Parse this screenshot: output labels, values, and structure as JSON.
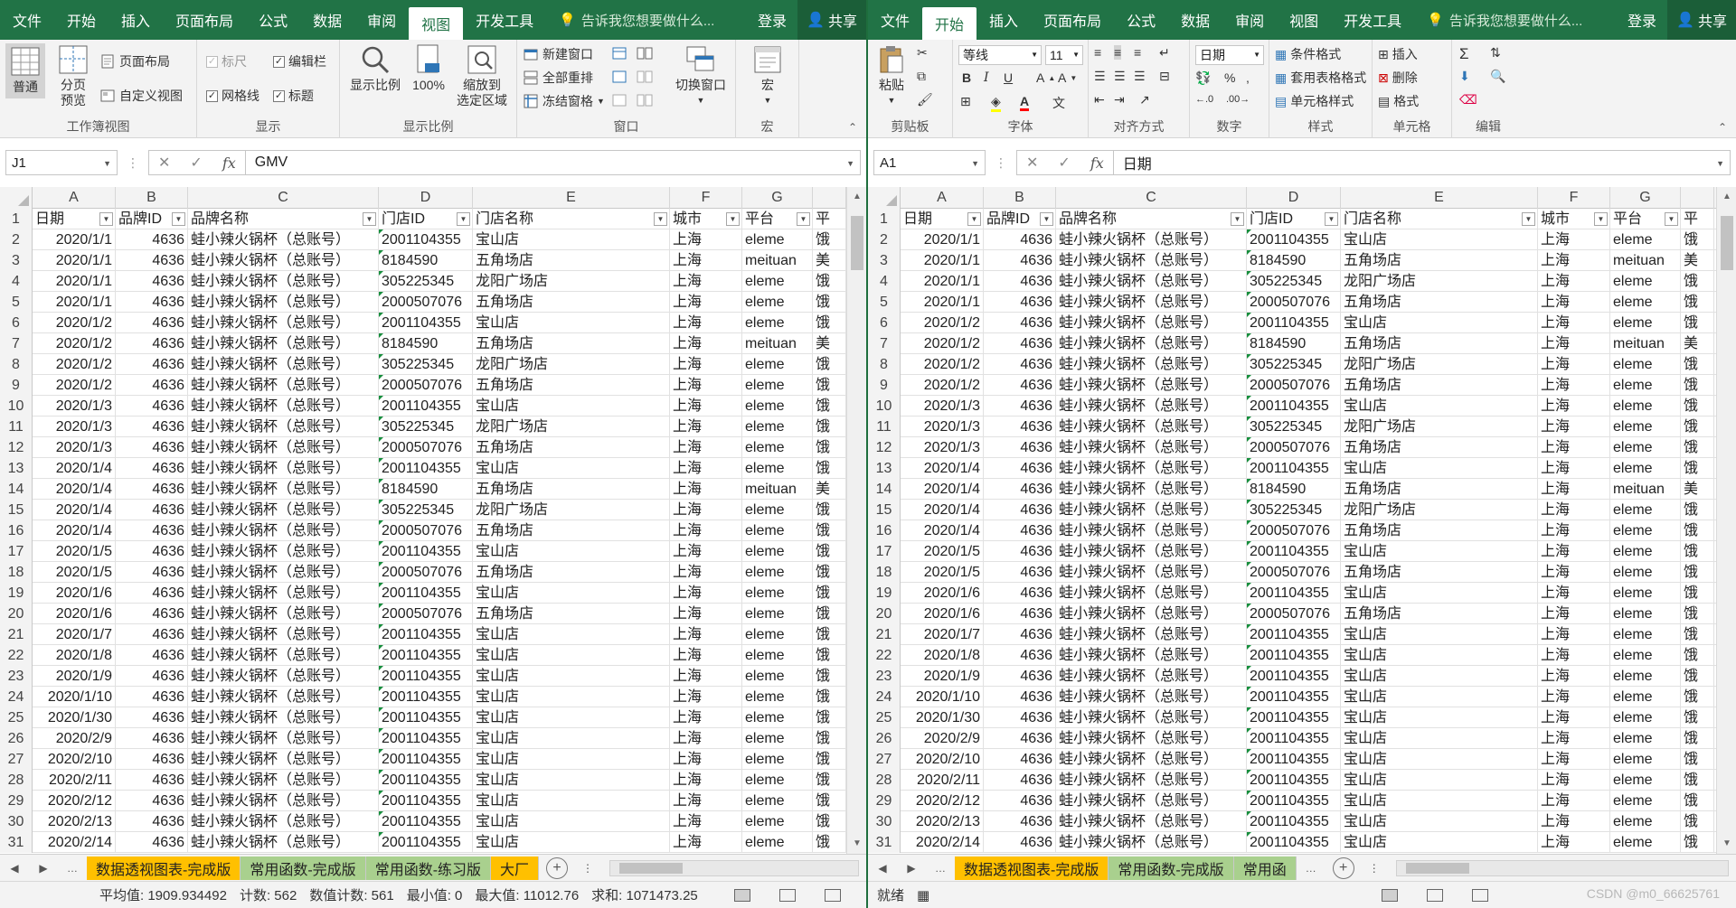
{
  "left": {
    "tabs": [
      "文件",
      "开始",
      "插入",
      "页面布局",
      "公式",
      "数据",
      "审阅",
      "视图",
      "开发工具"
    ],
    "active_tab": "视图",
    "tell_me": "告诉我您想要做什么...",
    "login": "登录",
    "share": "共享",
    "ribbon": {
      "g_workbook_views": {
        "label": "工作簿视图",
        "normal": "普通",
        "page_break": "分页\n预览",
        "page_layout": "页面布局",
        "custom_view": "自定义视图"
      },
      "g_show": {
        "label": "显示",
        "ruler": "标尺",
        "formula_bar": "编辑栏",
        "gridlines": "网格线",
        "headings": "标题"
      },
      "g_zoom": {
        "label": "显示比例",
        "zoom": "显示比例",
        "zoom100": "100%",
        "zoom_sel": "缩放到\n选定区域"
      },
      "g_window": {
        "label": "窗口",
        "new_window": "新建窗口",
        "arrange_all": "全部重排",
        "freeze": "冻结窗格",
        "switch": "切换窗口"
      },
      "g_macro": {
        "label": "宏",
        "macro": "宏"
      }
    },
    "name_box": "J1",
    "formula_value": "GMV",
    "columns": [
      "A",
      "B",
      "C",
      "D",
      "E",
      "F",
      "G",
      ""
    ],
    "header_row": [
      "日期",
      "品牌ID",
      "品牌名称",
      "门店ID",
      "门店名称",
      "城市",
      "平台",
      "平"
    ],
    "sheet_tabs": [
      {
        "label": "数据透视图表-完成版",
        "color": "#ffc000"
      },
      {
        "label": "常用函数-完成版",
        "color": "#a9d08e"
      },
      {
        "label": "常用函数-练习版",
        "color": "#a9d08e"
      },
      {
        "label": "大厂",
        "color": "#ffc000"
      }
    ],
    "status": {
      "avg": "平均值: 1909.934492",
      "count": "计数: 562",
      "numcount": "数值计数: 561",
      "min": "最小值: 0",
      "max": "最大值: 11012.76",
      "sum": "求和: 1071473.25"
    }
  },
  "right": {
    "tabs": [
      "文件",
      "开始",
      "插入",
      "页面布局",
      "公式",
      "数据",
      "审阅",
      "视图",
      "开发工具"
    ],
    "active_tab": "开始",
    "tell_me": "告诉我您想要做什么...",
    "login": "登录",
    "share": "共享",
    "ribbon": {
      "clipboard": {
        "label": "剪贴板",
        "paste": "粘贴"
      },
      "font": {
        "label": "字体",
        "name": "等线",
        "size": "11",
        "bold": "B",
        "italic": "I",
        "underline": "U"
      },
      "align": {
        "label": "对齐方式"
      },
      "number": {
        "label": "数字",
        "format": "日期",
        "percent": "%"
      },
      "styles": {
        "label": "样式",
        "cond": "条件格式",
        "table": "套用表格格式",
        "cell": "单元格样式"
      },
      "cells": {
        "label": "单元格",
        "insert": "插入",
        "delete": "删除",
        "format": "格式"
      },
      "edit": {
        "label": "编辑"
      }
    },
    "name_box": "A1",
    "formula_value": "日期",
    "columns": [
      "A",
      "B",
      "C",
      "D",
      "E",
      "F",
      "G",
      ""
    ],
    "header_row": [
      "日期",
      "品牌ID",
      "品牌名称",
      "门店ID",
      "门店名称",
      "城市",
      "平台",
      "平"
    ],
    "sheet_tabs": [
      {
        "label": "数据透视图表-完成版",
        "color": "#ffc000"
      },
      {
        "label": "常用函数-完成版",
        "color": "#a9d08e"
      },
      {
        "label": "常用函",
        "color": "#a9d08e"
      }
    ],
    "status": {
      "ready": "就绪"
    }
  },
  "rows": [
    {
      "n": 2,
      "date": "2020/1/1",
      "bid": "4636",
      "brand": "蛙小辣火锅杯（总账号）",
      "sid": "2001104355",
      "sname": "宝山店",
      "city": "上海",
      "plat": "eleme",
      "p2": "饿"
    },
    {
      "n": 3,
      "date": "2020/1/1",
      "bid": "4636",
      "brand": "蛙小辣火锅杯（总账号）",
      "sid": "8184590",
      "sname": "五角场店",
      "city": "上海",
      "plat": "meituan",
      "p2": "美"
    },
    {
      "n": 4,
      "date": "2020/1/1",
      "bid": "4636",
      "brand": "蛙小辣火锅杯（总账号）",
      "sid": "305225345",
      "sname": "龙阳广场店",
      "city": "上海",
      "plat": "eleme",
      "p2": "饿"
    },
    {
      "n": 5,
      "date": "2020/1/1",
      "bid": "4636",
      "brand": "蛙小辣火锅杯（总账号）",
      "sid": "2000507076",
      "sname": "五角场店",
      "city": "上海",
      "plat": "eleme",
      "p2": "饿"
    },
    {
      "n": 6,
      "date": "2020/1/2",
      "bid": "4636",
      "brand": "蛙小辣火锅杯（总账号）",
      "sid": "2001104355",
      "sname": "宝山店",
      "city": "上海",
      "plat": "eleme",
      "p2": "饿"
    },
    {
      "n": 7,
      "date": "2020/1/2",
      "bid": "4636",
      "brand": "蛙小辣火锅杯（总账号）",
      "sid": "8184590",
      "sname": "五角场店",
      "city": "上海",
      "plat": "meituan",
      "p2": "美"
    },
    {
      "n": 8,
      "date": "2020/1/2",
      "bid": "4636",
      "brand": "蛙小辣火锅杯（总账号）",
      "sid": "305225345",
      "sname": "龙阳广场店",
      "city": "上海",
      "plat": "eleme",
      "p2": "饿"
    },
    {
      "n": 9,
      "date": "2020/1/2",
      "bid": "4636",
      "brand": "蛙小辣火锅杯（总账号）",
      "sid": "2000507076",
      "sname": "五角场店",
      "city": "上海",
      "plat": "eleme",
      "p2": "饿"
    },
    {
      "n": 10,
      "date": "2020/1/3",
      "bid": "4636",
      "brand": "蛙小辣火锅杯（总账号）",
      "sid": "2001104355",
      "sname": "宝山店",
      "city": "上海",
      "plat": "eleme",
      "p2": "饿"
    },
    {
      "n": 11,
      "date": "2020/1/3",
      "bid": "4636",
      "brand": "蛙小辣火锅杯（总账号）",
      "sid": "305225345",
      "sname": "龙阳广场店",
      "city": "上海",
      "plat": "eleme",
      "p2": "饿"
    },
    {
      "n": 12,
      "date": "2020/1/3",
      "bid": "4636",
      "brand": "蛙小辣火锅杯（总账号）",
      "sid": "2000507076",
      "sname": "五角场店",
      "city": "上海",
      "plat": "eleme",
      "p2": "饿"
    },
    {
      "n": 13,
      "date": "2020/1/4",
      "bid": "4636",
      "brand": "蛙小辣火锅杯（总账号）",
      "sid": "2001104355",
      "sname": "宝山店",
      "city": "上海",
      "plat": "eleme",
      "p2": "饿"
    },
    {
      "n": 14,
      "date": "2020/1/4",
      "bid": "4636",
      "brand": "蛙小辣火锅杯（总账号）",
      "sid": "8184590",
      "sname": "五角场店",
      "city": "上海",
      "plat": "meituan",
      "p2": "美"
    },
    {
      "n": 15,
      "date": "2020/1/4",
      "bid": "4636",
      "brand": "蛙小辣火锅杯（总账号）",
      "sid": "305225345",
      "sname": "龙阳广场店",
      "city": "上海",
      "plat": "eleme",
      "p2": "饿"
    },
    {
      "n": 16,
      "date": "2020/1/4",
      "bid": "4636",
      "brand": "蛙小辣火锅杯（总账号）",
      "sid": "2000507076",
      "sname": "五角场店",
      "city": "上海",
      "plat": "eleme",
      "p2": "饿"
    },
    {
      "n": 17,
      "date": "2020/1/5",
      "bid": "4636",
      "brand": "蛙小辣火锅杯（总账号）",
      "sid": "2001104355",
      "sname": "宝山店",
      "city": "上海",
      "plat": "eleme",
      "p2": "饿"
    },
    {
      "n": 18,
      "date": "2020/1/5",
      "bid": "4636",
      "brand": "蛙小辣火锅杯（总账号）",
      "sid": "2000507076",
      "sname": "五角场店",
      "city": "上海",
      "plat": "eleme",
      "p2": "饿"
    },
    {
      "n": 19,
      "date": "2020/1/6",
      "bid": "4636",
      "brand": "蛙小辣火锅杯（总账号）",
      "sid": "2001104355",
      "sname": "宝山店",
      "city": "上海",
      "plat": "eleme",
      "p2": "饿"
    },
    {
      "n": 20,
      "date": "2020/1/6",
      "bid": "4636",
      "brand": "蛙小辣火锅杯（总账号）",
      "sid": "2000507076",
      "sname": "五角场店",
      "city": "上海",
      "plat": "eleme",
      "p2": "饿"
    },
    {
      "n": 21,
      "date": "2020/1/7",
      "bid": "4636",
      "brand": "蛙小辣火锅杯（总账号）",
      "sid": "2001104355",
      "sname": "宝山店",
      "city": "上海",
      "plat": "eleme",
      "p2": "饿"
    },
    {
      "n": 22,
      "date": "2020/1/8",
      "bid": "4636",
      "brand": "蛙小辣火锅杯（总账号）",
      "sid": "2001104355",
      "sname": "宝山店",
      "city": "上海",
      "plat": "eleme",
      "p2": "饿"
    },
    {
      "n": 23,
      "date": "2020/1/9",
      "bid": "4636",
      "brand": "蛙小辣火锅杯（总账号）",
      "sid": "2001104355",
      "sname": "宝山店",
      "city": "上海",
      "plat": "eleme",
      "p2": "饿"
    },
    {
      "n": 24,
      "date": "2020/1/10",
      "bid": "4636",
      "brand": "蛙小辣火锅杯（总账号）",
      "sid": "2001104355",
      "sname": "宝山店",
      "city": "上海",
      "plat": "eleme",
      "p2": "饿"
    },
    {
      "n": 25,
      "date": "2020/1/30",
      "bid": "4636",
      "brand": "蛙小辣火锅杯（总账号）",
      "sid": "2001104355",
      "sname": "宝山店",
      "city": "上海",
      "plat": "eleme",
      "p2": "饿"
    },
    {
      "n": 26,
      "date": "2020/2/9",
      "bid": "4636",
      "brand": "蛙小辣火锅杯（总账号）",
      "sid": "2001104355",
      "sname": "宝山店",
      "city": "上海",
      "plat": "eleme",
      "p2": "饿"
    },
    {
      "n": 27,
      "date": "2020/2/10",
      "bid": "4636",
      "brand": "蛙小辣火锅杯（总账号）",
      "sid": "2001104355",
      "sname": "宝山店",
      "city": "上海",
      "plat": "eleme",
      "p2": "饿"
    },
    {
      "n": 28,
      "date": "2020/2/11",
      "bid": "4636",
      "brand": "蛙小辣火锅杯（总账号）",
      "sid": "2001104355",
      "sname": "宝山店",
      "city": "上海",
      "plat": "eleme",
      "p2": "饿"
    },
    {
      "n": 29,
      "date": "2020/2/12",
      "bid": "4636",
      "brand": "蛙小辣火锅杯（总账号）",
      "sid": "2001104355",
      "sname": "宝山店",
      "city": "上海",
      "plat": "eleme",
      "p2": "饿"
    },
    {
      "n": 30,
      "date": "2020/2/13",
      "bid": "4636",
      "brand": "蛙小辣火锅杯（总账号）",
      "sid": "2001104355",
      "sname": "宝山店",
      "city": "上海",
      "plat": "eleme",
      "p2": "饿"
    },
    {
      "n": 31,
      "date": "2020/2/14",
      "bid": "4636",
      "brand": "蛙小辣火锅杯（总账号）",
      "sid": "2001104355",
      "sname": "宝山店",
      "city": "上海",
      "plat": "eleme",
      "p2": "饿"
    }
  ],
  "watermark": "CSDN @m0_66625761"
}
